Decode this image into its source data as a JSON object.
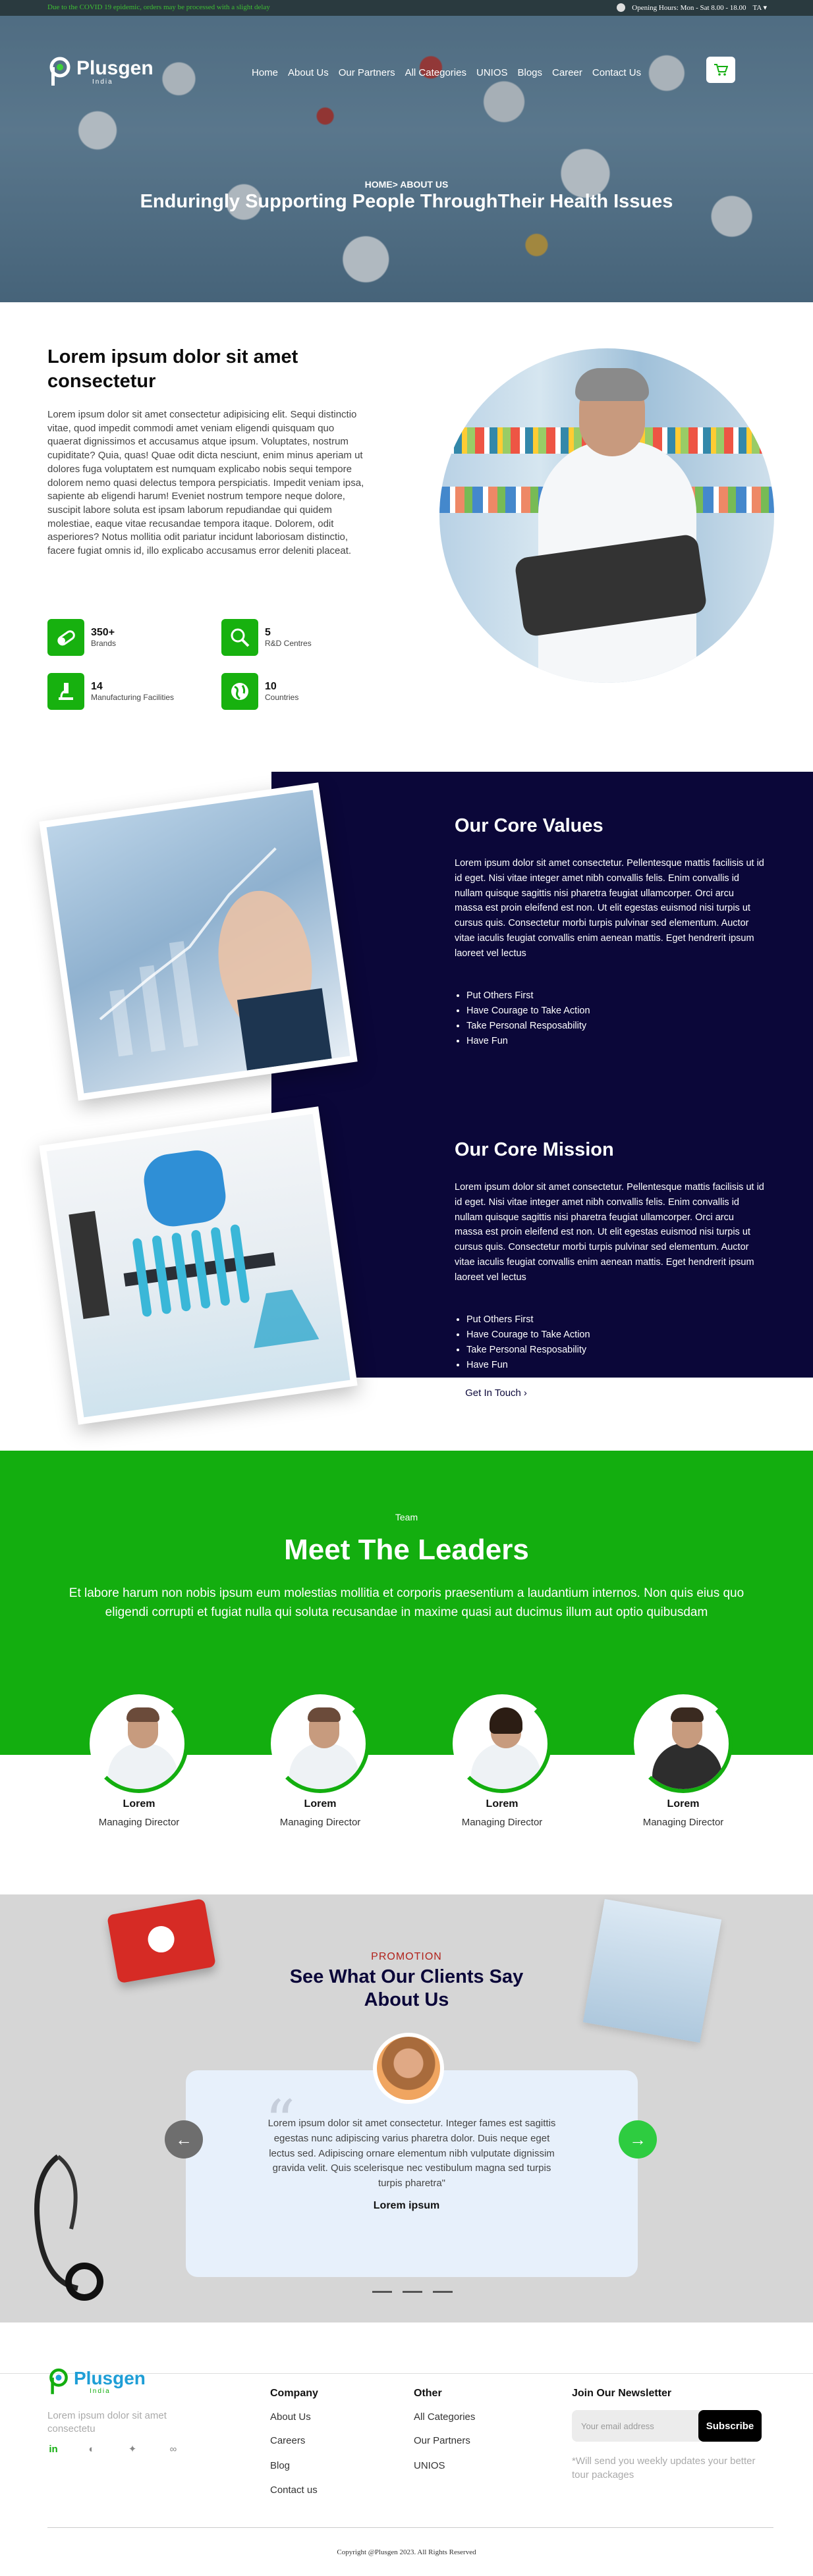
{
  "topbar": {
    "notice": "Due to the COVID 19 epidemic, orders may be processed with a slight delay",
    "hours": "Opening Hours: Mon - Sat 8.00 - 18.00",
    "language": "TA"
  },
  "brand": {
    "name": "Plusgen",
    "sub": "India"
  },
  "nav": [
    "Home",
    "About Us",
    "Our Partners",
    "All Categories",
    "UNIOS",
    "Blogs",
    "Career",
    "Contact Us"
  ],
  "hero": {
    "breadcrumb": "HOME> ABOUT US",
    "title": "Enduringly Supporting People ThroughTheir Health Issues"
  },
  "intro": {
    "title": "Lorem ipsum dolor sit amet consectetur",
    "body": "Lorem ipsum dolor sit amet consectetur adipisicing elit. Sequi distinctio vitae, quod impedit commodi amet veniam eligendi quisquam quo quaerat dignissimos et accusamus atque ipsum. Voluptates, nostrum cupiditate? Quia, quas! Quae odit dicta nesciunt, enim minus aperiam ut dolores fuga voluptatem est numquam explicabo nobis sequi tempore dolorem nemo quasi delectus tempora perspiciatis. Impedit veniam ipsa, sapiente ab eligendi harum! Eveniet nostrum tempore neque dolore, suscipit labore soluta est ipsam laborum repudiandae qui quidem molestiae, eaque vitae recusandae tempora itaque. Dolorem, odit asperiores? Notus mollitia odit pariatur incidunt laboriosam distinctio, facere fugiat omnis id, illo explicabo accusamus error deleniti placeat.",
    "stats": [
      {
        "num": "350+",
        "label": "Brands",
        "icon": "capsule-icon"
      },
      {
        "num": "5",
        "label": "R&D Centres",
        "icon": "research-icon"
      },
      {
        "num": "14",
        "label": "Manufacturing Facilities",
        "icon": "microscope-icon"
      },
      {
        "num": "10",
        "label": "Countries",
        "icon": "globe-icon"
      }
    ]
  },
  "values": {
    "title": "Our Core Values",
    "body": "Lorem ipsum dolor sit amet consectetur. Pellentesque mattis facilisis ut id id eget. Nisi vitae integer amet nibh convallis felis. Enim convallis id nullam quisque sagittis nisi pharetra feugiat ullamcorper. Orci arcu massa est proin eleifend est non. Ut elit egestas euismod nisi turpis ut cursus quis. Consectetur morbi turpis pulvinar sed elementum. Auctor vitae iaculis feugiat convallis enim aenean mattis. Eget hendrerit ipsum laoreet vel lectus",
    "list": [
      "Put Others First",
      "Have Courage to Take Action",
      "Take Personal Resposability",
      "Have Fun"
    ]
  },
  "mission": {
    "title": "Our Core Mission",
    "body": "Lorem ipsum dolor sit amet consectetur. Pellentesque mattis facilisis ut id id eget. Nisi vitae integer amet nibh convallis felis. Enim convallis id nullam quisque sagittis nisi pharetra feugiat ullamcorper. Orci arcu massa est proin eleifend est non. Ut elit egestas euismod nisi turpis ut cursus quis. Consectetur morbi turpis pulvinar sed elementum. Auctor vitae iaculis feugiat convallis enim aenean mattis. Eget hendrerit ipsum laoreet vel lectus",
    "list": [
      "Put Others First",
      "Have Courage to Take Action",
      "Take Personal Resposability",
      "Have Fun"
    ],
    "button": "Get In Touch"
  },
  "team": {
    "kicker": "Team",
    "title": "Meet The Leaders",
    "desc": "Et labore harum non nobis ipsum eum molestias mollitia et corporis praesentium a laudantium internos. Non quis eius quo eligendi corrupti et fugiat nulla qui soluta recusandae in maxime quasi aut ducimus illum aut optio quibusdam",
    "members": [
      {
        "name": "Lorem",
        "role": "Managing Director"
      },
      {
        "name": "Lorem",
        "role": "Managing Director"
      },
      {
        "name": "Lorem",
        "role": "Managing Director"
      },
      {
        "name": "Lorem",
        "role": "Managing Director"
      }
    ]
  },
  "testimonial": {
    "kicker": "PROMOTION",
    "title": "See What Our Clients Say About Us",
    "text": "Lorem ipsum dolor sit amet consectetur. Integer fames est sagittis egestas nunc adipiscing varius pharetra dolor. Duis neque eget lectus sed. Adipiscing ornare elementum nibh vulputate dignissim gravida velit. Quis scelerisque nec vestibulum magna sed turpis turpis pharetra\"",
    "name": "Lorem ipsum"
  },
  "footer": {
    "about": "Lorem ipsum dolor sit amet consectetu",
    "company_title": "Company",
    "company": [
      "About Us",
      "Careers",
      "Blog",
      "Contact us"
    ],
    "other_title": "Other",
    "other": [
      "All Categories",
      "Our Partners",
      "UNIOS"
    ],
    "newsletter_title": "Join Our Newsletter",
    "email_placeholder": "Your email address",
    "subscribe": "Subscribe",
    "note": "*Will send you weekly updates your better tour packages",
    "copyright": "Copyright @Plusgen 2023. All Rights Reserved"
  },
  "colors": {
    "green": "#13ae0f",
    "navy": "#0b0739",
    "red": "#b1221b"
  }
}
